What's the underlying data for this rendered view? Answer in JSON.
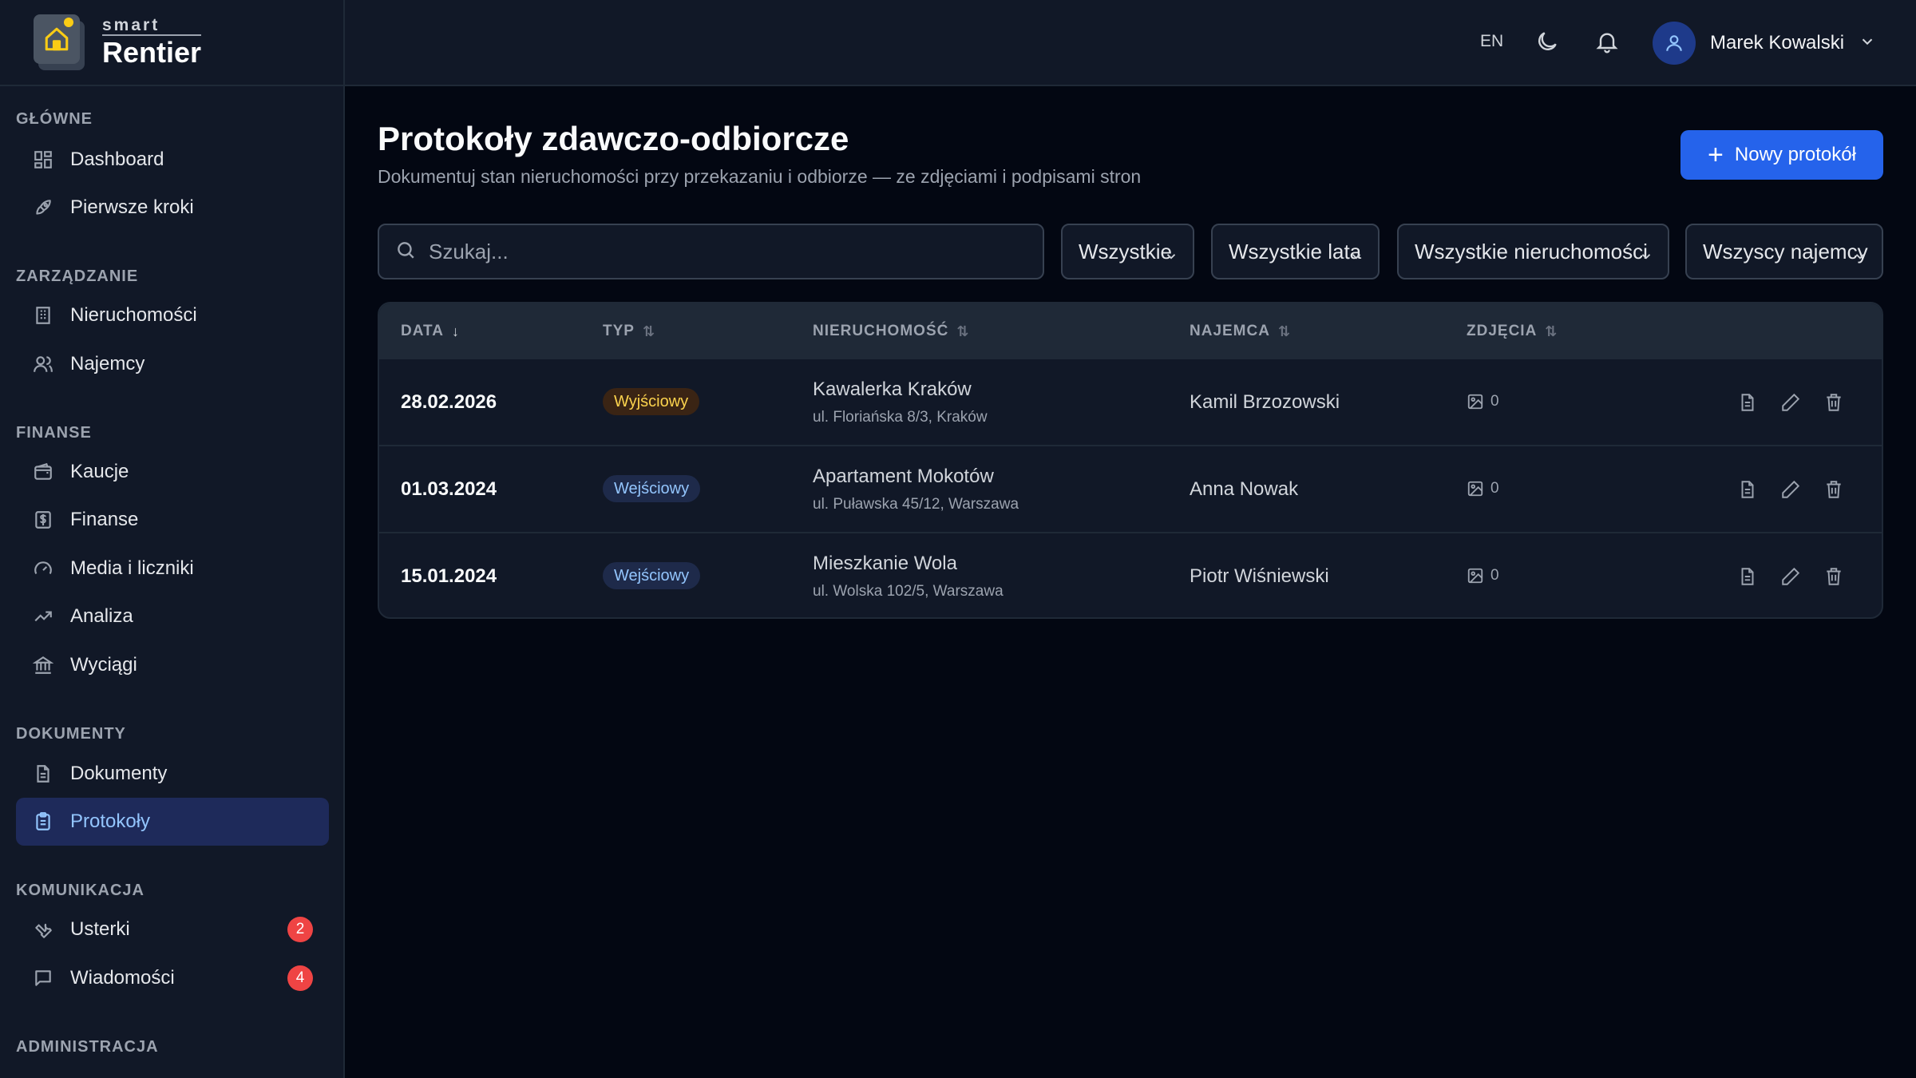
{
  "brand": {
    "small": "smart",
    "big": "Rentier"
  },
  "topbar": {
    "lang": "EN",
    "user_name": "Marek Kowalski"
  },
  "sidebar": {
    "sections": [
      {
        "label": "GŁÓWNE"
      },
      {
        "label": "ZARZĄDZANIE"
      },
      {
        "label": "FINANSE"
      },
      {
        "label": "DOKUMENTY"
      },
      {
        "label": "KOMUNIKACJA"
      },
      {
        "label": "ADMINISTRACJA"
      }
    ],
    "items": [
      {
        "label": "Dashboard",
        "icon": "dashboard-icon"
      },
      {
        "label": "Pierwsze kroki",
        "icon": "rocket-icon"
      },
      {
        "label": "Nieruchomości",
        "icon": "building-icon"
      },
      {
        "label": "Najemcy",
        "icon": "users-icon"
      },
      {
        "label": "Kaucje",
        "icon": "wallet-icon"
      },
      {
        "label": "Finanse",
        "icon": "dollar-icon"
      },
      {
        "label": "Media i liczniki",
        "icon": "gauge-icon"
      },
      {
        "label": "Analiza",
        "icon": "trend-icon"
      },
      {
        "label": "Wyciągi",
        "icon": "bank-icon"
      },
      {
        "label": "Dokumenty",
        "icon": "file-icon"
      },
      {
        "label": "Protokoły",
        "icon": "clipboard-icon",
        "active": true
      },
      {
        "label": "Usterki",
        "icon": "wrench-icon",
        "badge": "2"
      },
      {
        "label": "Wiadomości",
        "icon": "message-icon",
        "badge": "4"
      }
    ]
  },
  "main": {
    "title": "Protokoły zdawczo-odbiorcze",
    "subtitle": "Dokumentuj stan nieruchomości przy przekazaniu i odbiorze — ze zdjęciami i podpisami stron",
    "new_button": "Nowy protokół",
    "search_placeholder": "Szukaj...",
    "filters": [
      "Wszystkie",
      "Wszystkie lata",
      "Wszystkie nieruchomości",
      "Wszyscy najemcy"
    ],
    "columns": [
      "DATA",
      "TYP",
      "NIERUCHOMOŚĆ",
      "NAJEMCA",
      "ZDJĘCIA"
    ],
    "rows": [
      {
        "date": "28.02.2026",
        "type": "Wyjściowy",
        "kind": "out",
        "property": "Kawalerka Kraków",
        "address": "ul. Floriańska 8/3, Kraków",
        "tenant": "Kamil Brzozowski",
        "photos": "0"
      },
      {
        "date": "01.03.2024",
        "type": "Wejściowy",
        "kind": "in",
        "property": "Apartament Mokotów",
        "address": "ul. Puławska 45/12, Warszawa",
        "tenant": "Anna Nowak",
        "photos": "0"
      },
      {
        "date": "15.01.2024",
        "type": "Wejściowy",
        "kind": "in",
        "property": "Mieszkanie Wola",
        "address": "ul. Wolska 102/5, Warszawa",
        "tenant": "Piotr Wiśniewski",
        "photos": "0"
      }
    ]
  },
  "colors": {
    "accent": "#2563eb",
    "background": "#030712",
    "sidebar": "#111827",
    "badge": "#ef4444"
  }
}
